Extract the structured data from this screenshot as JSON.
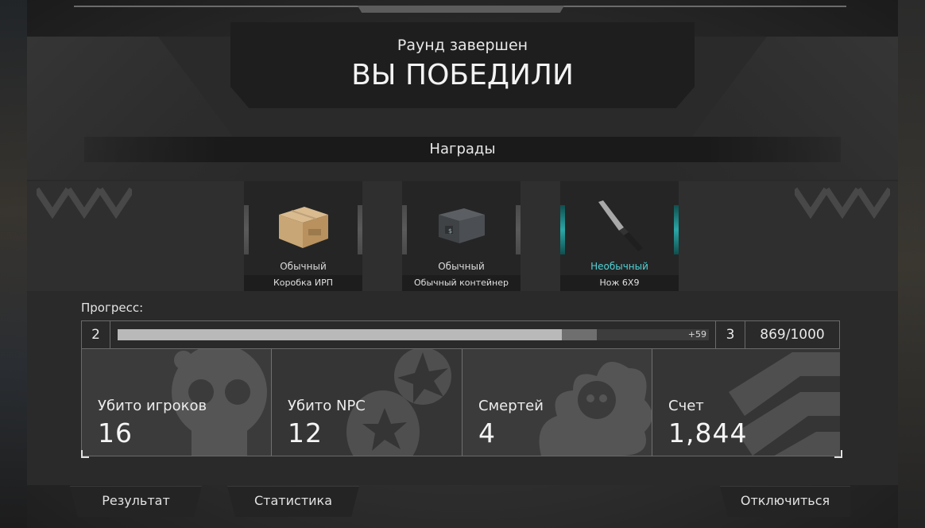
{
  "header": {
    "round_status": "Раунд завершен",
    "result": "ВЫ ПОБЕДИЛИ"
  },
  "rewards": {
    "title": "Награды",
    "items": [
      {
        "rarity": "Обычный",
        "name": "Коробка ИРП",
        "icon": "cardboard-box-icon"
      },
      {
        "rarity": "Обычный",
        "name": "Обычный контейнер",
        "icon": "metal-container-icon"
      },
      {
        "rarity": "Необычный",
        "name": "Нож 6Х9",
        "icon": "knife-icon"
      }
    ],
    "colors": {
      "common": "#dcdcdc",
      "uncommon": "#4fd3d8"
    }
  },
  "progress": {
    "label": "Прогресс:",
    "current_level": "2",
    "next_level": "3",
    "xp_gain_label": "+59",
    "xp_text": "869/1000",
    "fill_fraction": 0.81,
    "gain_fraction": 0.059
  },
  "stats": [
    {
      "label": "Убито игроков",
      "value": "16",
      "icon": "skull-icon"
    },
    {
      "label": "Убито NPC",
      "value": "12",
      "icon": "grenade-explosion-icon"
    },
    {
      "label": "Смертей",
      "value": "4",
      "icon": "skull-explosion-icon"
    },
    {
      "label": "Счет",
      "value": "1,844",
      "icon": "rank-chevron-icon"
    }
  ],
  "bottom_nav": {
    "result": "Результат",
    "statistics": "Статистика",
    "disconnect": "Отключиться"
  }
}
